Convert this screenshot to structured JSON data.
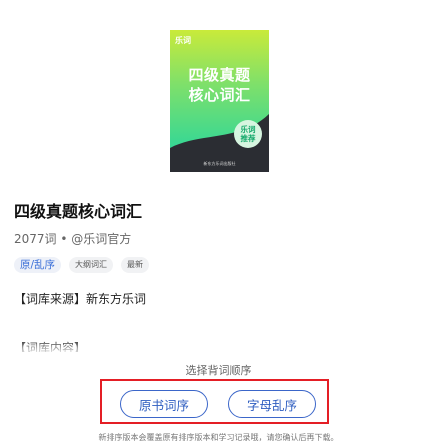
{
  "cover": {
    "brand": "乐词",
    "title_line1": "四级真题",
    "title_line2": "核心词汇",
    "badge_line1": "乐词",
    "badge_line2": "推荐",
    "publisher": "新东方乐词出版社"
  },
  "book": {
    "title": "四级真题核心词汇",
    "meta": "2077词 • @乐词官方",
    "tags": [
      "原/乱序",
      "大纲词汇",
      "最新"
    ]
  },
  "description": {
    "source": "【词库来源】新东方乐词",
    "content": "【词库内容】"
  },
  "order_panel": {
    "title": "选择背词顺序",
    "option_book_order": "原书词序",
    "option_alpha_random": "字母乱序",
    "warning": "新排序版本会覆盖原有排序版本和学习记录哦，请您确认后再下载。"
  }
}
